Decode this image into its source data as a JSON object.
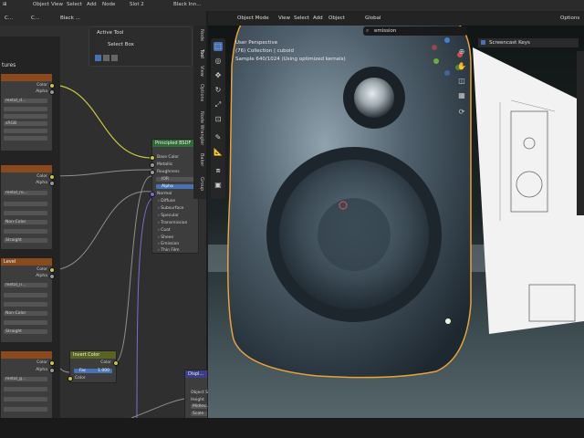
{
  "topbar": {
    "items": [
      "⊞",
      "Object",
      "View",
      "Select",
      "Add",
      "Node",
      "Slot 2",
      "Black Inn..."
    ]
  },
  "node_header": {
    "items": [
      "C...",
      "C...",
      "Black ..."
    ]
  },
  "left_panel": {
    "title": "tures",
    "rows_a": [
      "Color",
      "Alpha"
    ],
    "vals": [
      "metal_d...",
      "sRGB",
      "Repeat",
      "Straight"
    ]
  },
  "active_tool": {
    "title": "Active Tool",
    "label": "Select Box"
  },
  "node_tabs": [
    "Node",
    "Tool",
    "View",
    "Options",
    "Node Wrangler",
    "Baker",
    "Group"
  ],
  "image_nodes": [
    {
      "title": "",
      "out1": "Color",
      "out2": "Alpha",
      "file": "metal_d...",
      "cs": "sRGB",
      "ext": "Repeat",
      "alpha": "Straight"
    },
    {
      "title": "",
      "out1": "Color",
      "out2": "Alpha",
      "file": "metal_ro...",
      "cs": "Non-Color",
      "ext": "Repeat",
      "alpha": "Straight"
    },
    {
      "title": "Level",
      "out1": "Color",
      "out2": "Alpha",
      "file": "metal_n...",
      "cs": "Non-Color",
      "ext": "Repeat",
      "alpha": "Straight"
    },
    {
      "title": "",
      "out1": "Color",
      "out2": "Alpha",
      "file": "metal_g...",
      "cs": "Non-Color",
      "ext": "Repeat",
      "alpha": "Straight"
    }
  ],
  "bsdf": {
    "title": "Principled BSDF",
    "inputs": [
      "Base Color",
      "Metallic",
      "Roughness",
      "IOR",
      "Alpha",
      "Normal",
      "Diffuse",
      "Subsurface",
      "Specular",
      "Transmission",
      "Coat",
      "Sheen",
      "Emission",
      "Thin Film"
    ],
    "ior_val": "1.50",
    "alpha_val": "1.000"
  },
  "invert_node": {
    "title": "Invert Color",
    "out": "Color",
    "fac_label": "Fac",
    "fac_val": "1.000",
    "in": "Color"
  },
  "disp_node": {
    "title": "Displ...",
    "rows": [
      "Object S...",
      "Height",
      "Midlev...",
      "Scale"
    ]
  },
  "viewport_header": {
    "items": [
      "Object Mode",
      "View",
      "Select",
      "Add",
      "Object",
      "Global",
      "Options"
    ]
  },
  "viewport": {
    "line1": "User Perspective",
    "line2": "(76) Collection | cuboid",
    "line3": "Sample 640/1024 (Using optimized kernels)",
    "search_value": "emission",
    "screencast_label": "Screencast Keys"
  },
  "colors": {
    "image_node_header": "#8a4a1c",
    "bsdf_header": "#2f6b34",
    "invert_header": "#5a6420",
    "disp_header": "#3b3f8a",
    "link_yellow": "#c8c83a",
    "link_gray": "#8f8f8f",
    "selection_outline": "#e8a23a",
    "active_field": "#4772b3"
  }
}
